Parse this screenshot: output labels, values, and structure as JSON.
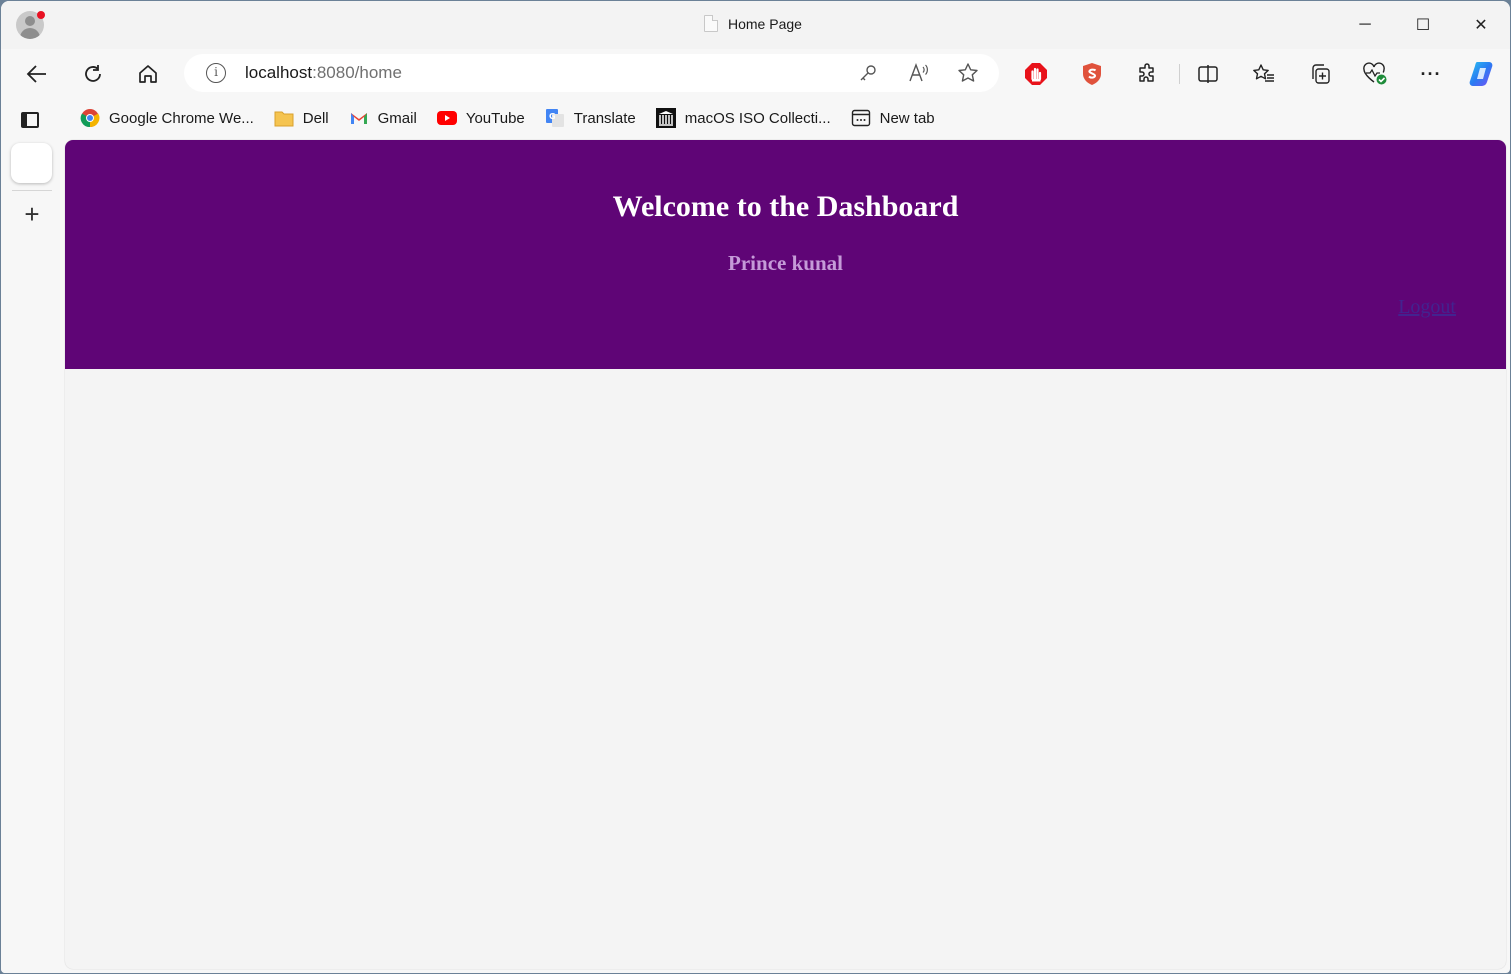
{
  "browser": {
    "tab_title": "Home Page",
    "window_controls": {
      "minimize": "─",
      "maximize": "☐",
      "close": "✕"
    },
    "address_bar": {
      "host": "localhost",
      "rest": ":8080/home"
    },
    "nav_icons": [
      "back-icon",
      "refresh-icon",
      "home-icon"
    ],
    "address_icons": [
      "key-icon",
      "read-aloud-icon",
      "favorite-star-icon"
    ],
    "toolbar_icons": [
      "adblock-icon",
      "security-extension-icon",
      "extensions-icon",
      "split-screen-icon",
      "favorites-icon",
      "collections-icon",
      "browser-essentials-icon",
      "more-icon",
      "copilot-icon"
    ],
    "bookmarks": [
      {
        "label": "Google Chrome We...",
        "icon": "chrome-icon"
      },
      {
        "label": "Dell",
        "icon": "folder-icon"
      },
      {
        "label": "Gmail",
        "icon": "gmail-icon"
      },
      {
        "label": "YouTube",
        "icon": "youtube-icon"
      },
      {
        "label": "Translate",
        "icon": "translate-icon"
      },
      {
        "label": "macOS ISO Collecti...",
        "icon": "archive-icon"
      },
      {
        "label": "New tab",
        "icon": "new-tab-icon"
      }
    ],
    "more_label": "···"
  },
  "page": {
    "header": {
      "title": "Welcome to the Dashboard",
      "username": "Prince kunal",
      "logout_label": "Logout",
      "background_color": "#5f0576"
    }
  }
}
